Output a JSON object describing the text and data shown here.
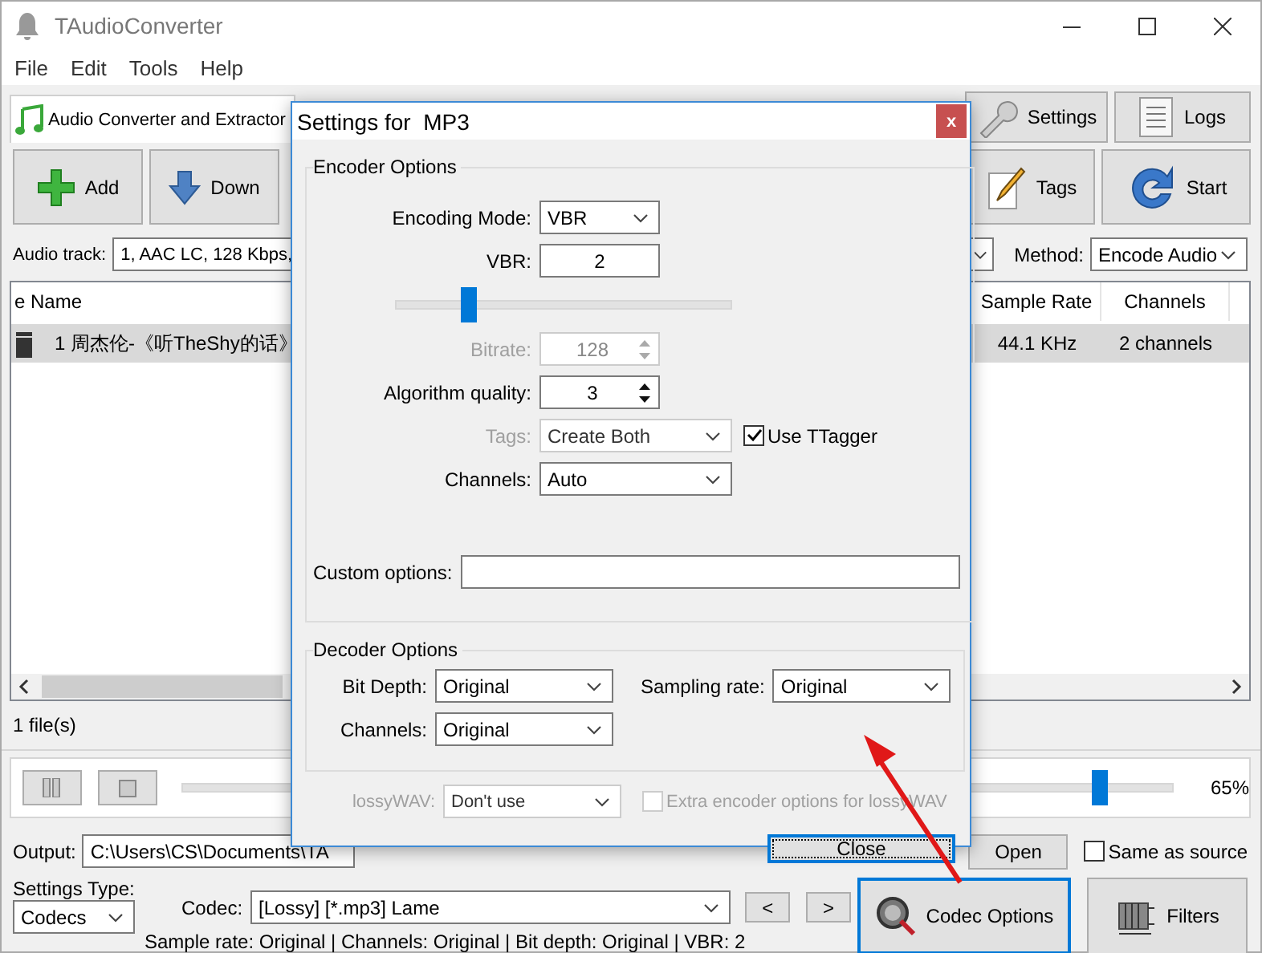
{
  "window": {
    "title": "TAudioConverter"
  },
  "menu": [
    "File",
    "Edit",
    "Tools",
    "Help"
  ],
  "tab": {
    "label": "Audio Converter and Extractor"
  },
  "top_buttons": [
    "Settings",
    "Logs"
  ],
  "toolbar_left": [
    "Add",
    "Down"
  ],
  "toolbar_right": [
    "Tags",
    "Start"
  ],
  "audio_track": {
    "label": "Audio track:",
    "value": "1, AAC LC, 128 Kbps,"
  },
  "method": {
    "label": "Method:",
    "value": "Encode Audio"
  },
  "table": {
    "columns": [
      "e Name",
      "Sample Rate",
      "Channels"
    ],
    "rows": [
      {
        "name": "1 周杰伦-《听TheShy的话》",
        "sample_rate": "44.1 KHz",
        "channels": "2 channels",
        "selected": true
      }
    ]
  },
  "file_count": "1 file(s)",
  "volume": {
    "level": 0.92,
    "reading": "65%"
  },
  "output": {
    "label": "Output:",
    "value": "C:\\Users\\CS\\Documents\\TA",
    "button": "Open",
    "same_as_source": {
      "label": "Same as source",
      "checked": false
    }
  },
  "settings_type": {
    "label": "Settings Type:",
    "value": "Codecs"
  },
  "codec": {
    "label": "Codec:",
    "value": "[Lossy] [*.mp3] Lame",
    "prev": "<",
    "next": ">"
  },
  "big_buttons": [
    {
      "label": "Codec Options",
      "focused": true
    },
    {
      "label": "Filters",
      "focused": false
    }
  ],
  "status": "Sample rate: Original | Channels: Original | Bit depth: Original | VBR: 2",
  "dialog": {
    "title": "Settings for  MP3",
    "close": "x",
    "encoder": {
      "title": "Encoder Options",
      "encoding_mode": {
        "label": "Encoding Mode:",
        "value": "VBR"
      },
      "vbr": {
        "label": "VBR:",
        "value": "2",
        "level": 0.22
      },
      "bitrate": {
        "label": "Bitrate:",
        "value": "128",
        "disabled": true
      },
      "algorithm_quality": {
        "label": "Algorithm quality:",
        "value": "3",
        "disabled": false
      },
      "tags": {
        "label": "Tags:",
        "value": "Create Both",
        "disabled": true
      },
      "use_ttagger": {
        "label": "Use TTagger",
        "checked": true
      },
      "channels": {
        "label": "Channels:",
        "value": "Auto"
      },
      "custom_options": {
        "label": "Custom options:"
      }
    },
    "decoder": {
      "title": "Decoder Options",
      "bit_depth": {
        "label": "Bit Depth:",
        "value": "Original"
      },
      "sampling_rate": {
        "label": "Sampling rate:",
        "value": "Original"
      },
      "channels": {
        "label": "Channels:",
        "value": "Original"
      }
    },
    "lossywav": {
      "label": "lossyWAV:",
      "value": "Don't use",
      "disabled": true
    },
    "extra_encoder": {
      "label": "Extra encoder options for lossyWAV",
      "checked": false,
      "disabled": true
    },
    "close_button": "Close"
  }
}
